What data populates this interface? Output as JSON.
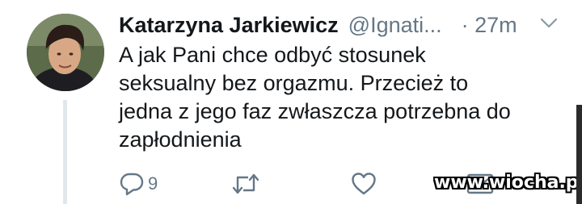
{
  "tweet": {
    "author_name": "Katarzyna Jarkiewicz",
    "author_handle": "@Ignati...",
    "time": "· 27m",
    "text_lines": [
      "A jak Pani chce odbyć stosunek",
      "seksualny bez orgazmu. Przecież to",
      "jedna z jego faz zwłaszcza potrzebna do",
      "zapłodnienia"
    ],
    "reply_count": "9"
  },
  "icons": {
    "caret": "chevron-down-icon",
    "reply": "reply-icon",
    "retweet": "retweet-icon",
    "like": "heart-icon",
    "dm": "envelope-icon"
  },
  "watermark": "www.wiocha.pl",
  "colors": {
    "text": "#14171a",
    "secondary": "#657786",
    "thread_line": "#e1e8ed"
  }
}
